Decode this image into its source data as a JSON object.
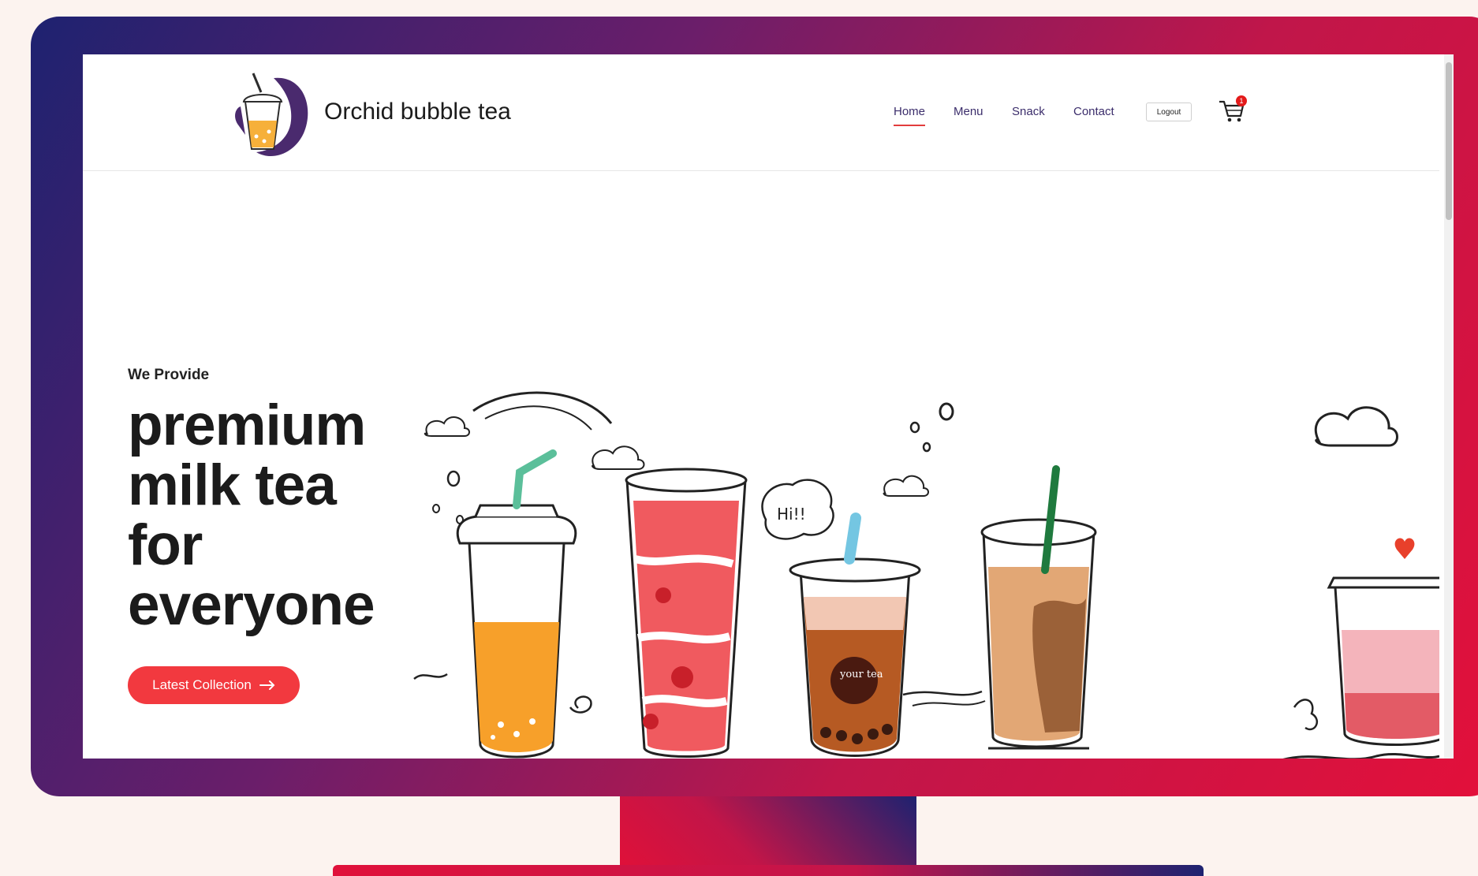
{
  "brand": {
    "name": "Orchid bubble tea"
  },
  "nav": {
    "links": [
      {
        "label": "Home",
        "active": true
      },
      {
        "label": "Menu",
        "active": false
      },
      {
        "label": "Snack",
        "active": false
      },
      {
        "label": "Contact",
        "active": false
      }
    ],
    "logout_label": "Logout",
    "cart_count": "1"
  },
  "hero": {
    "eyebrow": "We Provide",
    "title_lines": [
      "premium",
      "milk tea",
      "for",
      "everyone"
    ],
    "cta_label": "Latest Collection",
    "cta_icon": "arrow-right-icon",
    "cup_label": "your tea",
    "bubble_text": "Hi!!"
  },
  "colors": {
    "accent": "#f2393f",
    "nav_text": "#3b2d6b",
    "badge": "#e31b1b",
    "frame_gradient": [
      "#1e2270",
      "#6b1e6a",
      "#c0164a",
      "#e3103a"
    ]
  }
}
